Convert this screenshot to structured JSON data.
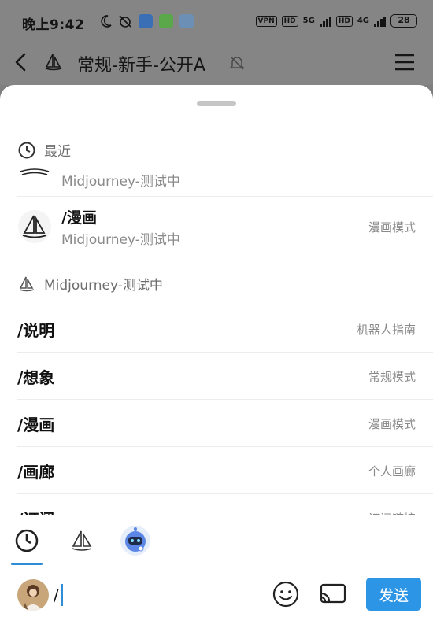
{
  "status_bar": {
    "time": "晚上9:42",
    "vpn": "VPN",
    "hd1": "HD",
    "net1": "5G",
    "hd2": "HD",
    "net2": "4G",
    "battery": "28"
  },
  "header": {
    "title": "常规-新手-公开A"
  },
  "sheet": {
    "recent_header": "最近",
    "recent_items": [
      {
        "title": "",
        "subtitle": "Midjourney-测试中",
        "right": ""
      },
      {
        "title": "/漫画",
        "subtitle": "Midjourney-测试中",
        "right": "漫画模式"
      }
    ],
    "bot_header": "Midjourney-测试中",
    "commands": [
      {
        "name": "/说明",
        "desc": "机器人指南"
      },
      {
        "name": "/想象",
        "desc": "常规模式"
      },
      {
        "name": "/漫画",
        "desc": "漫画模式"
      },
      {
        "name": "/画廊",
        "desc": "个人画廊"
      },
      {
        "name": "/订阅",
        "desc": "订阅链接"
      }
    ]
  },
  "input": {
    "value": "/",
    "send_label": "发送"
  },
  "colors": {
    "accent": "#2d95e6",
    "overlay": "#858585",
    "muted_text": "#8a8a8a"
  },
  "icons": {
    "back": "back-arrow-icon",
    "logo": "sailboat-logo-icon",
    "mute": "bell-off-icon",
    "menu": "hamburger-menu-icon",
    "recent": "clock-icon",
    "emoji": "emoji-icon",
    "cast": "screen-cast-icon",
    "bot": "robot-avatar-icon"
  }
}
